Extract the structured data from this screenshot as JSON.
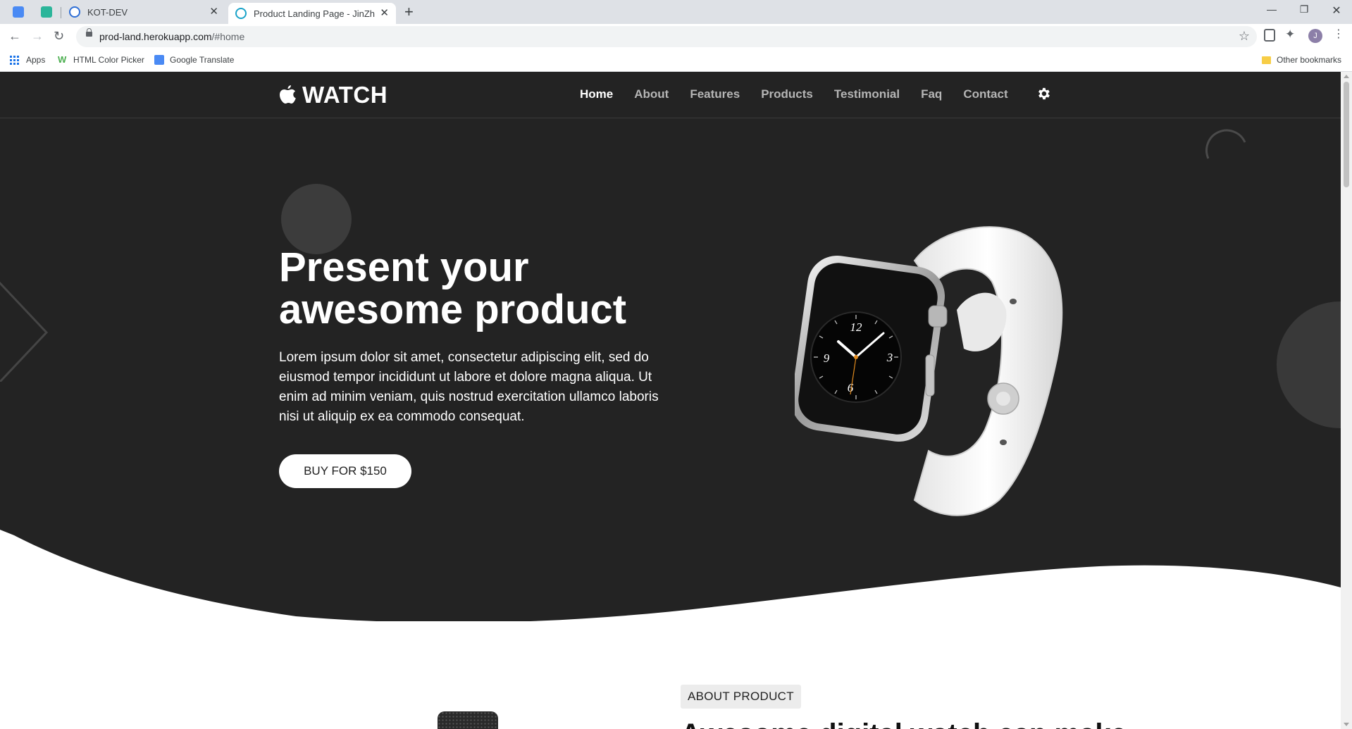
{
  "browser": {
    "tabs": [
      {
        "label": "KOT-DEV",
        "active": false
      },
      {
        "label": "Product Landing Page - JinZh",
        "active": true
      }
    ],
    "url_host": "prod-land.herokuapp.com",
    "url_path": "/#home",
    "bookmarks": [
      "Apps",
      "HTML Color Picker",
      "Google Translate"
    ],
    "other_bookmarks": "Other bookmarks",
    "profile_initial": "J"
  },
  "site": {
    "logo": "WATCH",
    "nav": [
      "Home",
      "About",
      "Features",
      "Products",
      "Testimonial",
      "Faq",
      "Contact"
    ],
    "active_nav": "Home"
  },
  "hero": {
    "title_line1": "Present your",
    "title_line2": "awesome product",
    "text": "Lorem ipsum dolor sit amet, consectetur adipiscing elit, sed do eiusmod tempor incididunt ut labore et dolore magna aliqua. Ut enim ad minim veniam, quis nostrud exercitation ullamco laboris nisi ut aliquip ex ea commodo consequat.",
    "button": "BUY FOR $150",
    "watch_numerals": [
      "12",
      "3",
      "6",
      "9"
    ]
  },
  "about": {
    "badge": "ABOUT PRODUCT",
    "heading": "Awesome digital watch can make"
  },
  "colors": {
    "hero_bg": "#232323",
    "nav_active": "#ffffff",
    "nav_inactive": "#b5b5b5"
  }
}
